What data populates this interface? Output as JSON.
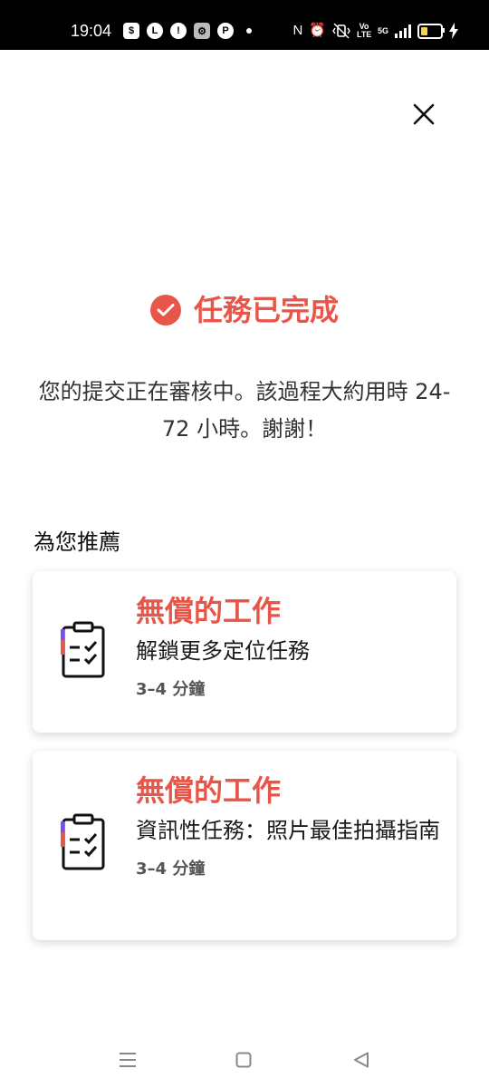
{
  "status_bar": {
    "time": "19:04",
    "left_icons": [
      "shopping-bag-icon",
      "l-app-icon",
      "alarm-app-icon",
      "settings-app-icon",
      "p-app-icon"
    ],
    "left_icon_glyphs": [
      "$",
      "L",
      "!",
      "⚙",
      "P"
    ],
    "nfc": "N",
    "volte": "Vo\nLTE",
    "network": "5G",
    "battery_color": "#f2d34a"
  },
  "header": {
    "close_icon": "close-icon"
  },
  "completion": {
    "title": "任務已完成",
    "message": "您的提交正在審核中。該過程大約用時 24-72 小時。謝謝！",
    "accent_color": "#e8564a"
  },
  "recommendations": {
    "title": "為您推薦",
    "items": [
      {
        "kicker": "無償的工作",
        "title": "解鎖更多定位任務",
        "duration": "3–4 分鐘",
        "icon": "clipboard-checklist-icon"
      },
      {
        "kicker": "無償的工作",
        "title": "資訊性任務：照片最佳拍攝指南",
        "duration": "3–4 分鐘",
        "icon": "clipboard-checklist-icon"
      }
    ]
  },
  "nav_bar": {
    "buttons": [
      "menu-icon",
      "home-icon",
      "back-icon"
    ]
  }
}
